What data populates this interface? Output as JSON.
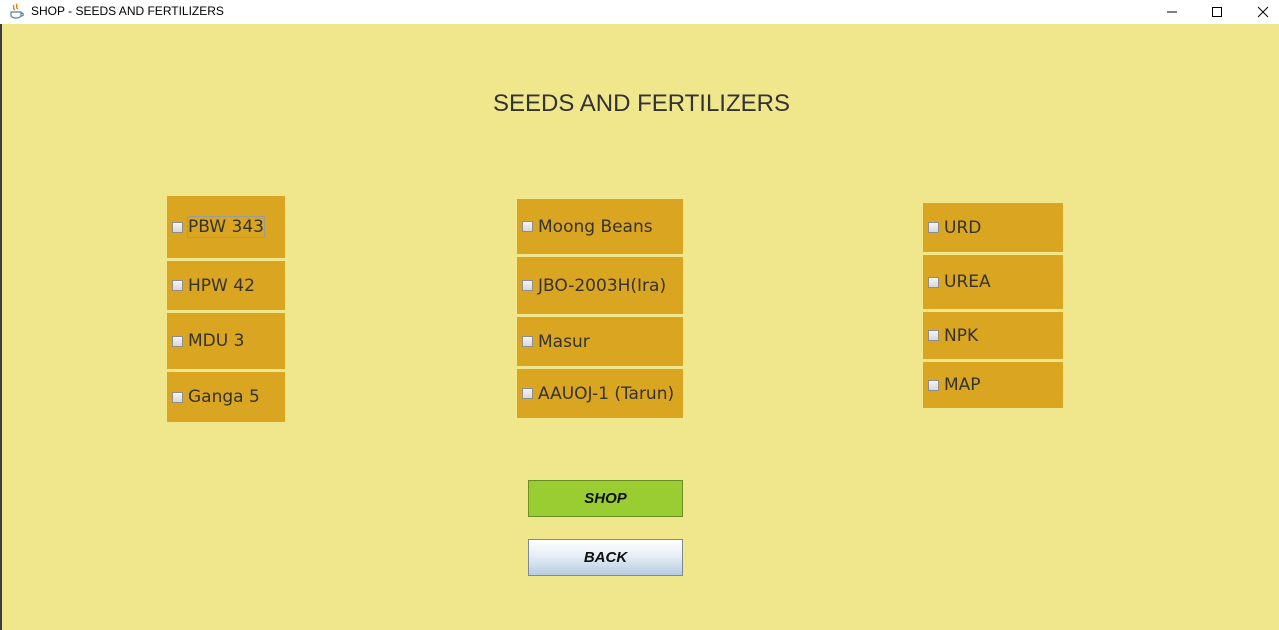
{
  "window": {
    "title": "SHOP - SEEDS AND FERTILIZERS"
  },
  "page": {
    "heading": "SEEDS AND FERTILIZERS"
  },
  "columns": [
    {
      "items": [
        "PBW 343",
        "HPW 42",
        "MDU 3",
        "Ganga 5"
      ]
    },
    {
      "items": [
        "Moong Beans",
        "JBO-2003H(Ira)",
        "Masur",
        "AAUOJ-1 (Tarun)"
      ]
    },
    {
      "items": [
        "URD",
        "UREA",
        "NPK",
        "MAP"
      ]
    }
  ],
  "buttons": {
    "shop": "SHOP",
    "back": "BACK"
  },
  "colors": {
    "background": "#f0e68c",
    "item": "#daa520",
    "shop_button": "#9acd32"
  },
  "icons": {
    "app": "java-coffee-icon",
    "minimize": "minimize-icon",
    "maximize": "maximize-icon",
    "close": "close-icon"
  }
}
